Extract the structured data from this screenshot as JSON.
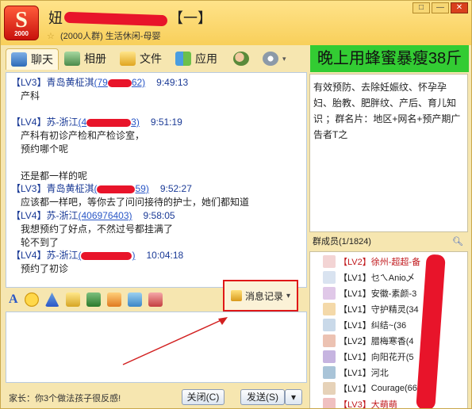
{
  "header": {
    "logo_letter": "S",
    "logo_year": "2000",
    "title_prefix": "妞",
    "title_suffix": "【一】",
    "group_count": "(2000人群)",
    "group_category": "生活休闲-母婴"
  },
  "window_controls": [
    "□",
    "—",
    "✕"
  ],
  "tabs": [
    {
      "label": "聊天",
      "icon": "chat-icon"
    },
    {
      "label": "相册",
      "icon": "album-icon"
    },
    {
      "label": "文件",
      "icon": "folder-icon"
    },
    {
      "label": "应用",
      "icon": "apps-icon"
    }
  ],
  "ad_banner": "晚上用蜂蜜暴瘦38斤",
  "messages": [
    {
      "level": "【LV3】",
      "name": "青岛黄柾淇",
      "id_visible": "(79",
      "id_end": "62)",
      "time": "9:49:13",
      "lines": [
        "产科"
      ]
    },
    {
      "level": "【LV4】",
      "name": "苏-浙江",
      "id_visible": "(4",
      "id_end": "3)",
      "time": "9:51:19",
      "lines": [
        "产科有初诊产检和产检诊室，",
        "预约哪个呢",
        "",
        "还是都一样的呢"
      ]
    },
    {
      "level": "【LV3】",
      "name": "青岛黄柾淇",
      "id_visible": "(",
      "id_end": "59)",
      "time": "9:52:27",
      "lines": [
        "应该都一样吧，等你去了问问接待的护士，她们都知道"
      ]
    },
    {
      "level": "【LV4】",
      "name": "苏-浙江",
      "id_visible": "(406976403)",
      "id_end": "",
      "time": "9:58:05",
      "lines": [
        "我想预约了好点，不然过号都挂满了",
        "轮不到了"
      ]
    },
    {
      "level": "【LV4】",
      "name": "苏-浙江",
      "id_visible": "(",
      "id_end": ")",
      "time": "10:04:18",
      "lines": [
        "预约了初诊"
      ]
    }
  ],
  "input_toolbar": {
    "history_label": "消息记录",
    "history_arrow": "▾"
  },
  "footer": {
    "tip": "家长：你3个做法孩子很反感!",
    "close_label": "关闭(C)",
    "send_label": "发送(S)",
    "send_arrow": "▾"
  },
  "notice_text": "有效预防、去除妊娠纹、怀孕孕妇、胎教、肥胖纹、产后、育儿知识 ；群名片：地区+网名+预产期广告者T之",
  "members_header": "群成员(1/1824)",
  "members": [
    {
      "level": "【LV2】",
      "name": "徐州-超超-备",
      "red": true
    },
    {
      "level": "【LV1】",
      "name": "乜ㄟAnio乄",
      "red": false
    },
    {
      "level": "【LV1】",
      "name": "安徽-素颜-3",
      "red": false
    },
    {
      "level": "【LV1】",
      "name": "守护精灵(34",
      "red": false
    },
    {
      "level": "【LV1】",
      "name": "纠结~(36",
      "red": false
    },
    {
      "level": "【LV2】",
      "name": "腊梅寒香(4",
      "red": false
    },
    {
      "level": "【LV1】",
      "name": "向阳花开(5",
      "red": false
    },
    {
      "level": "【LV1】",
      "name": "河北",
      "red": false
    },
    {
      "level": "【LV1】",
      "name": "Courage(66",
      "red": false
    },
    {
      "level": "【LV3】",
      "name": "大萌萌",
      "red": true
    }
  ],
  "colors": {
    "header_bg": "#f8cf5a",
    "ad_bg": "#33cc33",
    "highlight_border": "#e01818",
    "redaction": "#e8142a",
    "level_name": "#1a3a96"
  }
}
